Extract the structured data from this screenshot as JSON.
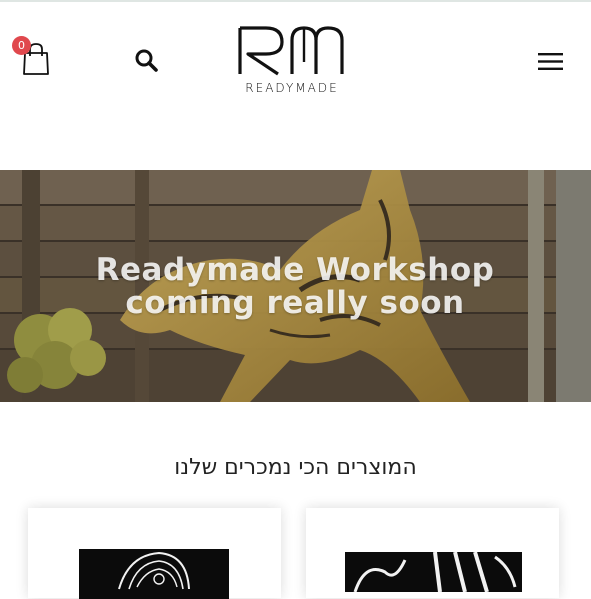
{
  "header": {
    "cart_count": "0",
    "logo_letters": "RM",
    "logo_word": "READYMADE"
  },
  "hero": {
    "title": "Readymade Workshop coming really soon"
  },
  "section": {
    "title": "המוצרים הכי נמכרים שלנו"
  },
  "icons": [
    "shopping-bag-icon",
    "search-icon",
    "hamburger-menu-icon"
  ],
  "colors": {
    "badge": "#e0484d",
    "hero_text": "#ffffff",
    "gold": "#a8893c"
  }
}
